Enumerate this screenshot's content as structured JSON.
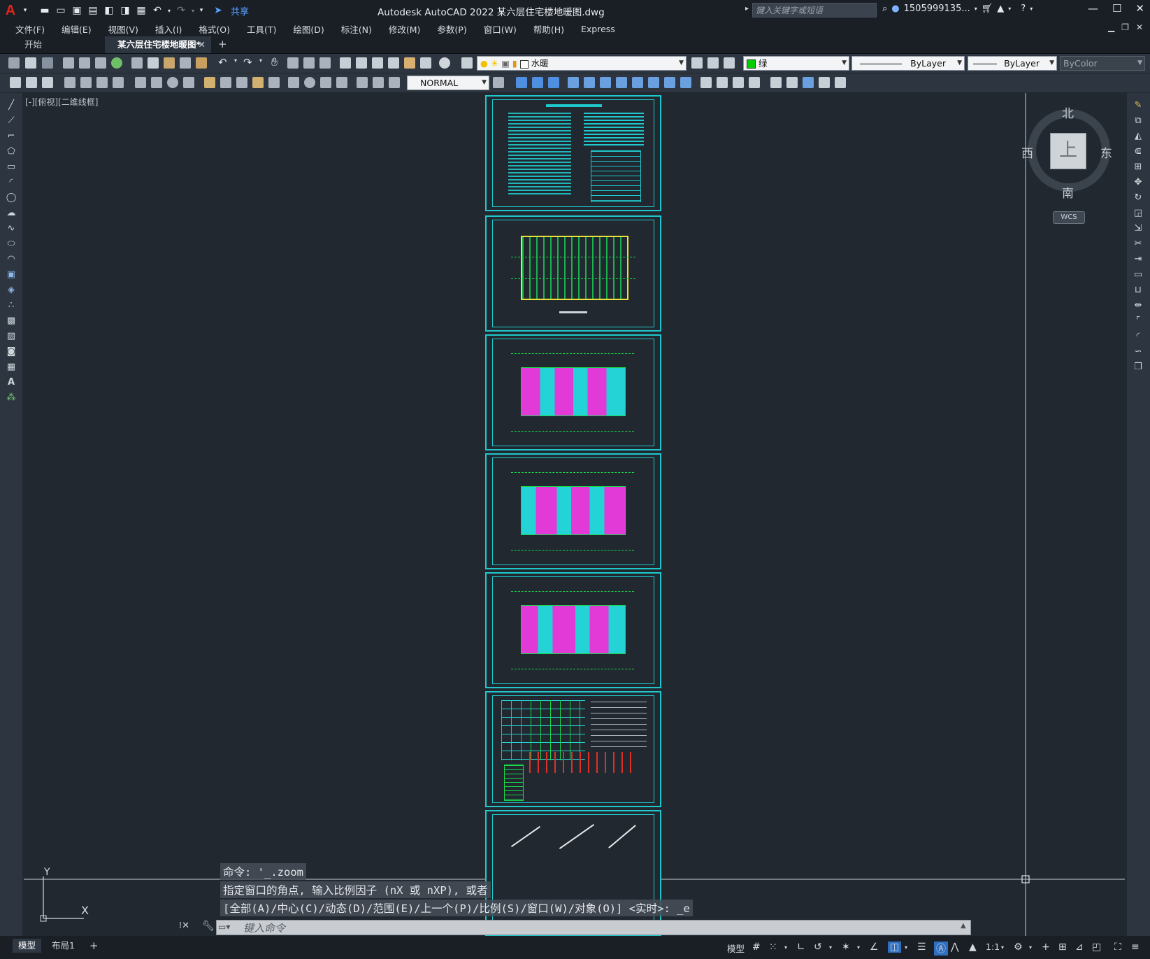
{
  "app": {
    "logo_letter": "A",
    "title": "Autodesk AutoCAD 2022    某六层住宅楼地暖图.dwg",
    "share_label": "共享",
    "search_placeholder": "键入关键字或短语",
    "user": "1505999135...",
    "accent_color": "#1ec8cc"
  },
  "menubar": {
    "items": [
      "文件(F)",
      "编辑(E)",
      "视图(V)",
      "插入(I)",
      "格式(O)",
      "工具(T)",
      "绘图(D)",
      "标注(N)",
      "修改(M)",
      "参数(P)",
      "窗口(W)",
      "帮助(H)",
      "Express"
    ]
  },
  "tabs": {
    "start": "开始",
    "doc": "某六层住宅楼地暖图*",
    "close": "✕",
    "add": "+"
  },
  "toolbar": {
    "layer_name": "水暖",
    "color_name": "绿",
    "linetype": "ByLayer",
    "lineweight": "ByLayer",
    "plotstyle": "ByColor",
    "textstyle": "NORMAL"
  },
  "viewport": {
    "label": "[-][俯视][二维线框]"
  },
  "compass": {
    "north": "北",
    "south": "南",
    "east": "东",
    "west": "西",
    "top": "上",
    "wcs": "WCS"
  },
  "ucs": {
    "x": "X",
    "y": "Y"
  },
  "command": {
    "history": [
      "命令: '_.zoom",
      "指定窗口的角点, 输入比例因子 (nX 或 nXP), 或者",
      "[全部(A)/中心(C)/动态(D)/范围(E)/上一个(P)/比例(S)/窗口(W)/对象(O)] <实时>: _e"
    ],
    "input_placeholder": "键入命令"
  },
  "status": {
    "tab_model": "模型",
    "tab_layout1": "布局1",
    "add": "+",
    "model_label": "模型",
    "scale": "1:1"
  }
}
